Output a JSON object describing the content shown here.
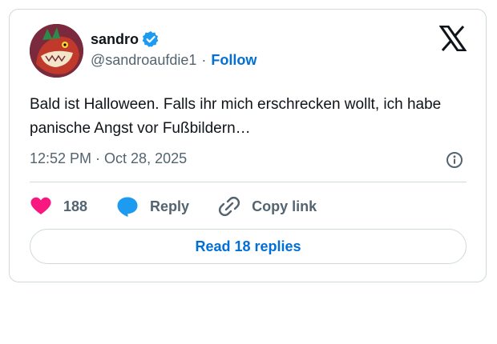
{
  "tweet": {
    "author": {
      "display_name": "sandro",
      "handle": "@sandroaufdie1",
      "verified": true
    },
    "follow_label": "Follow",
    "separator": "·",
    "text": "Bald ist Halloween. Falls ihr mich erschrecken wollt, ich habe panische Angst vor Fußbildern…",
    "timestamp": "12:52 PM · Oct 28, 2025"
  },
  "actions": {
    "like_count": "188",
    "reply_label": "Reply",
    "copy_label": "Copy link"
  },
  "read_replies_label": "Read 18 replies",
  "colors": {
    "accent": "#006fd6",
    "like": "#f91880",
    "reply": "#1d9bf0",
    "verified": "#1d9bf0",
    "muted": "#536471",
    "border": "#cfd9de"
  },
  "icons": [
    "x-logo-icon",
    "verified-badge-icon",
    "info-icon",
    "heart-icon",
    "reply-bubble-icon",
    "link-icon"
  ]
}
